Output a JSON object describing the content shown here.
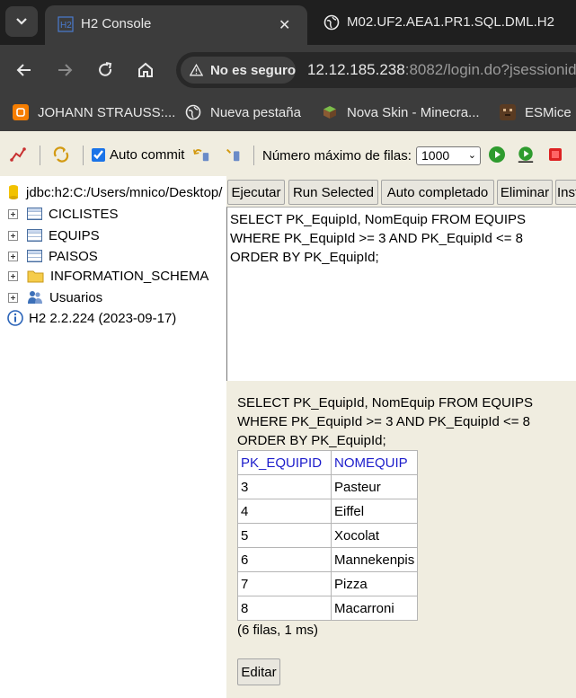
{
  "browser": {
    "tabs": [
      {
        "title": "H2 Console",
        "active": true,
        "icon": "h2-favicon"
      },
      {
        "title": "M02.UF2.AEA1.PR1.SQL.DML.H2",
        "active": false,
        "icon": "globe-icon"
      }
    ],
    "address": {
      "security_label": "No es seguro",
      "url_host": "12.12.185.238",
      "url_rest": ":8082/login.do?jsessionid"
    },
    "bookmarks": [
      {
        "label": "JOHANN STRAUSS:...",
        "icon": "blogger-icon"
      },
      {
        "label": "Nueva pestaña",
        "icon": "globe-icon"
      },
      {
        "label": "Nova Skin - Minecra...",
        "icon": "minecraft-block-icon"
      },
      {
        "label": "ESMice",
        "icon": "esmice-icon"
      }
    ]
  },
  "toolbar": {
    "autocommit_label": "Auto commit",
    "autocommit_checked": true,
    "max_rows_label": "Número máximo de filas:",
    "max_rows_value": "1000"
  },
  "tree": {
    "connection": "jdbc:h2:C:/Users/mnico/Desktop/",
    "items": [
      {
        "label": "CICLISTES",
        "icon": "table-icon"
      },
      {
        "label": "EQUIPS",
        "icon": "table-icon"
      },
      {
        "label": "PAISOS",
        "icon": "table-icon"
      },
      {
        "label": "INFORMATION_SCHEMA",
        "icon": "folder-icon"
      },
      {
        "label": "Usuarios",
        "icon": "users-icon"
      }
    ],
    "version": "H2 2.2.224 (2023-09-17)"
  },
  "buttons": {
    "run": "Ejecutar",
    "run_selected": "Run Selected",
    "autocomplete": "Auto completado",
    "delete": "Eliminar",
    "instructions": "Inst"
  },
  "editor": {
    "lines": [
      "SELECT PK_EquipId, NomEquip FROM EQUIPS",
      "WHERE PK_EquipId >= 3 AND PK_EquipId <= 8",
      "ORDER BY PK_EquipId;"
    ]
  },
  "results": {
    "sql_lines": [
      "SELECT PK_EquipId, NomEquip FROM EQUIPS",
      "WHERE PK_EquipId >= 3 AND PK_EquipId <= 8",
      "ORDER BY PK_EquipId;"
    ],
    "columns": [
      "PK_EQUIPID",
      "NOMEQUIP"
    ],
    "rows": [
      [
        "3",
        "Pasteur"
      ],
      [
        "4",
        "Eiffel"
      ],
      [
        "5",
        "Xocolat"
      ],
      [
        "6",
        "Mannekenpis"
      ],
      [
        "7",
        "Pizza"
      ],
      [
        "8",
        "Macarroni"
      ]
    ],
    "row_count": "(6 filas, 1 ms)",
    "edit_label": "Editar"
  }
}
